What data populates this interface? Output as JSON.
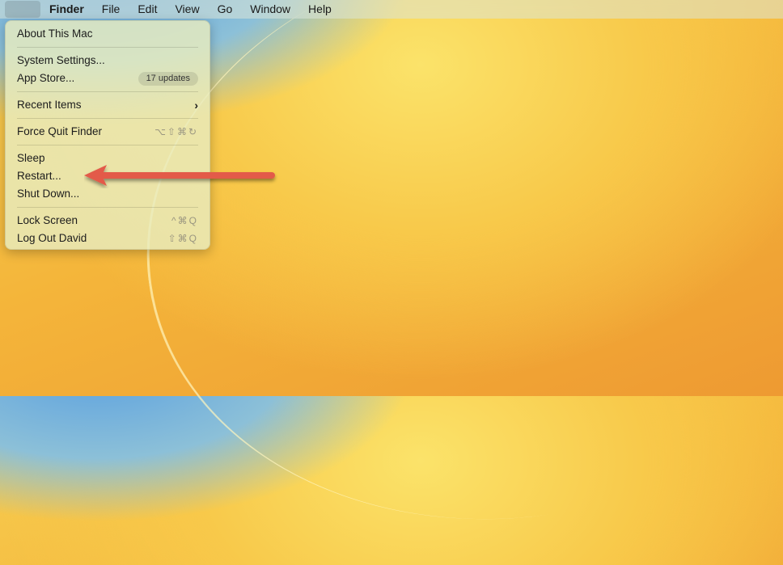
{
  "menubar": {
    "apple": "",
    "items": [
      "Finder",
      "File",
      "Edit",
      "View",
      "Go",
      "Window",
      "Help"
    ]
  },
  "apple_menu": {
    "about": "About This Mac",
    "settings": "System Settings...",
    "appstore": "App Store...",
    "appstore_badge": "17 updates",
    "recent": "Recent Items",
    "recent_chevron": "›",
    "forcequit": "Force Quit Finder",
    "forcequit_shortcut": "⌥⇧⌘↻",
    "sleep": "Sleep",
    "restart": "Restart...",
    "shutdown": "Shut Down...",
    "lock": "Lock Screen",
    "lock_shortcut": "^⌘Q",
    "logout": "Log Out David",
    "logout_shortcut": "⇧⌘Q"
  },
  "colors": {
    "annotation_arrow": "#e35a48"
  }
}
